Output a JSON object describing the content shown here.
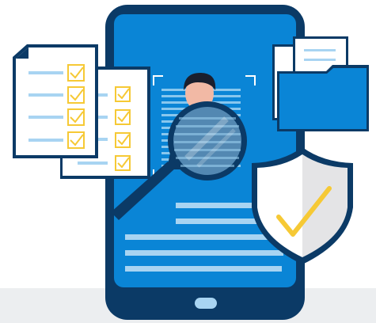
{
  "illustration": {
    "subject": "identity-verification",
    "colors": {
      "navy": "#0b3a66",
      "phone_blue": "#0a85d6",
      "screen_light": "#9fd3f3",
      "lens_tint": "#5a8fb8",
      "paper": "#ffffff",
      "paper_line": "#a8d4f2",
      "check_yellow": "#f6c935",
      "folder_blue": "#0a85d6",
      "shield_grey": "#e4e4e6",
      "skin": "#f2b9a5",
      "hair": "#1a1f2e",
      "floor_grey": "#eceef0",
      "home_button": "#a8d4f2"
    },
    "icons": [
      "smartphone-icon",
      "checklist-document-icon",
      "folder-icon",
      "magnifier-icon",
      "user-profile-icon",
      "shield-check-icon"
    ]
  }
}
